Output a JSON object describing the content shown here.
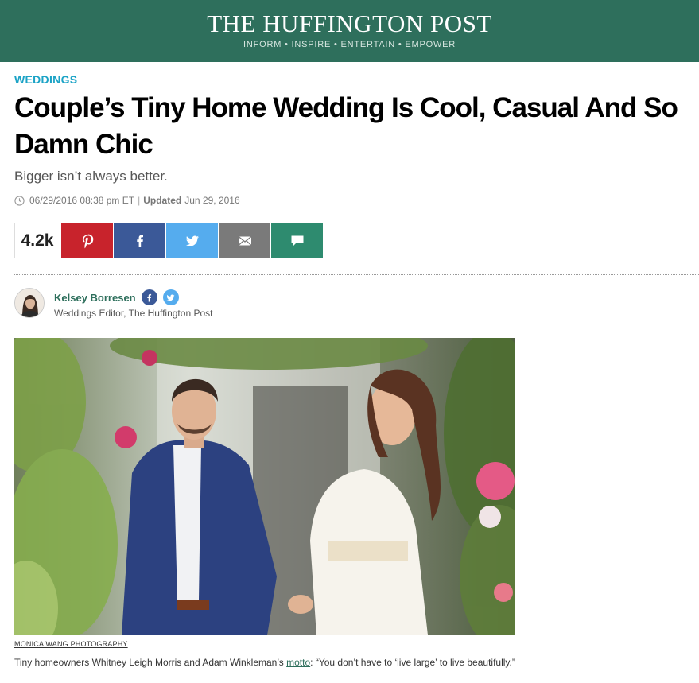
{
  "masthead": {
    "brand": "THE HUFFINGTON POST",
    "tagline": "INFORM • INSPIRE • ENTERTAIN • EMPOWER"
  },
  "article": {
    "section": "WEDDINGS",
    "headline": "Couple’s Tiny Home Wedding Is Cool, Casual And So Damn Chic",
    "subhead": "Bigger isn’t always better.",
    "published": "06/29/2016 08:38 pm ET",
    "updated_label": "Updated",
    "updated_date": "Jun 29, 2016"
  },
  "share": {
    "count": "4.2k",
    "buttons": [
      {
        "name": "pinterest",
        "icon": "pinterest-icon",
        "color": "#c8232c"
      },
      {
        "name": "facebook",
        "icon": "facebook-icon",
        "color": "#3b5998"
      },
      {
        "name": "twitter",
        "icon": "twitter-icon",
        "color": "#55acee"
      },
      {
        "name": "email",
        "icon": "email-icon",
        "color": "#7a7a7a"
      },
      {
        "name": "comment",
        "icon": "comment-icon",
        "color": "#2e8b6f"
      }
    ]
  },
  "author": {
    "name": "Kelsey Borresen",
    "title": "Weddings Editor, The Huffington Post",
    "social": [
      {
        "icon": "facebook-icon",
        "color": "#3b5998"
      },
      {
        "icon": "twitter-icon",
        "color": "#55acee"
      }
    ]
  },
  "photo": {
    "credit": "MONICA WANG PHOTOGRAPHY",
    "caption_before": "Tiny homeowners Whitney Leigh Morris and Adam Winkleman’s ",
    "caption_link": "motto",
    "caption_after": ": “You don’t have to ‘live large’ to live beautifully.”"
  },
  "colors": {
    "brand_green": "#2e6f5c",
    "section_blue": "#1ba3c6"
  }
}
